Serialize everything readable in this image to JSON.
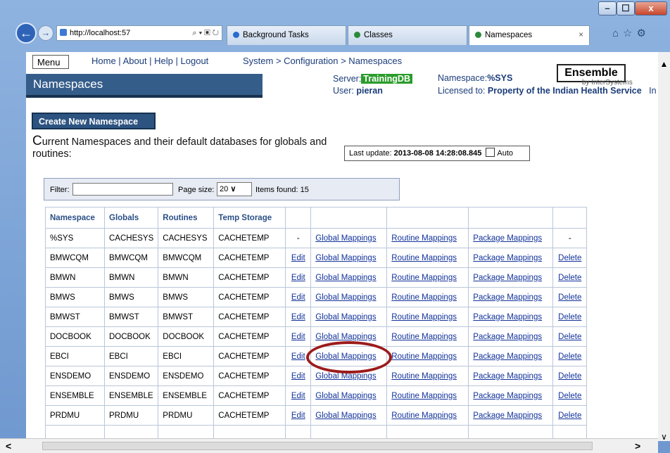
{
  "browser": {
    "address": "http://localhost:57",
    "address_tools": "⌕ ▾ ▣ ↻",
    "tabs": [
      {
        "label": "Background Tasks"
      },
      {
        "label": "Classes"
      },
      {
        "label": "Namespaces",
        "close": "×"
      }
    ],
    "window_buttons": {
      "minimize": "–",
      "maximize": "☐",
      "close": "x"
    },
    "toolbar_icons": "⌂☆⚙",
    "back_glyph": "←",
    "forward_glyph": "→"
  },
  "scrollbars": {
    "up": "▲",
    "down": "∨",
    "left": "<",
    "right": ">"
  },
  "page": {
    "menu_label": "Menu",
    "top_links": [
      "Home",
      "About",
      "Help",
      "Logout"
    ],
    "link_sep": " | ",
    "breadcrumb": "System > Configuration > Namespaces",
    "title": "Namespaces",
    "server_label": "Server:",
    "server_value": "TrainingDB",
    "user_label": "User:",
    "user_value": "pieran",
    "namespace_label": "Namespace:",
    "namespace_value": "%SYS",
    "licensed_label": "Licensed to:",
    "licensed_value": "Property of the Indian Health Service",
    "licensed_trailing": "In",
    "logo": "Ensemble",
    "logo_sub": "by InterSystems",
    "create_button": "Create New Namespace",
    "intro_first": "C",
    "intro_rest": "urrent Namespaces and their default databases for globals and routines:",
    "last_update_label": "Last update:",
    "last_update_value": "2013-08-08 14:28:08.845",
    "auto_label": "Auto",
    "filter_label": "Filter:",
    "page_size_label": "Page size:",
    "page_size_value": "20",
    "items_found_label": "Items found:",
    "items_found_value": "15"
  },
  "table": {
    "headers": [
      "Namespace",
      "Globals",
      "Routines",
      "Temp Storage",
      "",
      "",
      "",
      "",
      ""
    ],
    "rows": [
      [
        "%SYS",
        "CACHESYS",
        "CACHESYS",
        "CACHETEMP",
        "-",
        "Global Mappings",
        "Routine Mappings",
        "Package Mappings",
        "-"
      ],
      [
        "BMWCQM",
        "BMWCQM",
        "BMWCQM",
        "CACHETEMP",
        "Edit",
        "Global Mappings",
        "Routine Mappings",
        "Package Mappings",
        "Delete"
      ],
      [
        "BMWN",
        "BMWN",
        "BMWN",
        "CACHETEMP",
        "Edit",
        "Global Mappings",
        "Routine Mappings",
        "Package Mappings",
        "Delete"
      ],
      [
        "BMWS",
        "BMWS",
        "BMWS",
        "CACHETEMP",
        "Edit",
        "Global Mappings",
        "Routine Mappings",
        "Package Mappings",
        "Delete"
      ],
      [
        "BMWST",
        "BMWST",
        "BMWST",
        "CACHETEMP",
        "Edit",
        "Global Mappings",
        "Routine Mappings",
        "Package Mappings",
        "Delete"
      ],
      [
        "DOCBOOK",
        "DOCBOOK",
        "DOCBOOK",
        "CACHETEMP",
        "Edit",
        "Global Mappings",
        "Routine Mappings",
        "Package Mappings",
        "Delete"
      ],
      [
        "EBCI",
        "EBCI",
        "EBCI",
        "CACHETEMP",
        "Edit",
        "Global Mappings",
        "Routine Mappings",
        "Package Mappings",
        "Delete"
      ],
      [
        "ENSDEMO",
        "ENSDEMO",
        "ENSDEMO",
        "CACHETEMP",
        "Edit",
        "Global Mappings",
        "Routine Mappings",
        "Package Mappings",
        "Delete"
      ],
      [
        "ENSEMBLE",
        "ENSEMBLE",
        "ENSEMBLE",
        "CACHETEMP",
        "Edit",
        "Global Mappings",
        "Routine Mappings",
        "Package Mappings",
        "Delete"
      ],
      [
        "PRDMU",
        "PRDMU",
        "PRDMU",
        "CACHETEMP",
        "Edit",
        "Global Mappings",
        "Routine Mappings",
        "Package Mappings",
        "Delete"
      ],
      [
        "",
        "",
        "",
        "",
        "",
        "",
        "",
        "",
        ""
      ]
    ]
  }
}
